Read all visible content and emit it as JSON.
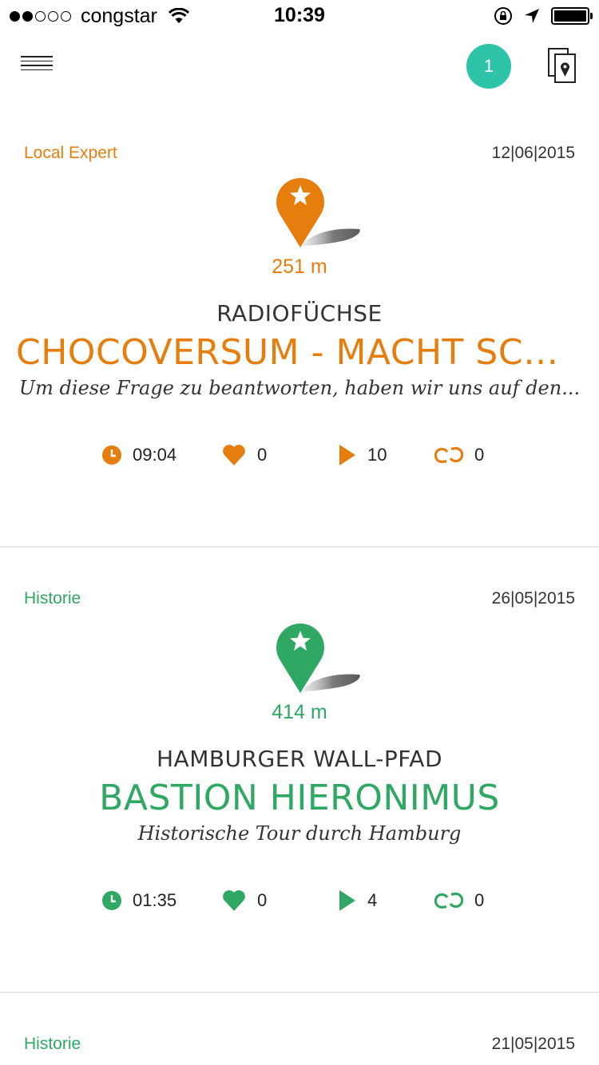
{
  "status_bar": {
    "carrier": "congstar",
    "time": "10:39"
  },
  "nav": {
    "badge_count": "1"
  },
  "cards": [
    {
      "category": "Local Expert",
      "date": "12|06|2015",
      "color": "#e67e0e",
      "distance": "251 m",
      "subtitle": "RADIOFÜCHSE",
      "title": "CHOCOVERSUM - MACHT SCH...",
      "description": "Um diese Frage zu beantworten, haben wir uns auf den...",
      "stats": {
        "duration": "09:04",
        "likes": "0",
        "plays": "10",
        "shares": "0"
      }
    },
    {
      "category": "Historie",
      "date": "26|05|2015",
      "color": "#2ea863",
      "distance": "414 m",
      "subtitle": "HAMBURGER WALL-PFAD",
      "title": "BASTION HIERONIMUS",
      "description": "Historische Tour durch Hamburg",
      "stats": {
        "duration": "01:35",
        "likes": "0",
        "plays": "4",
        "shares": "0"
      }
    },
    {
      "category": "Historie",
      "date": "21|05|2015",
      "color": "#2ea863"
    }
  ]
}
